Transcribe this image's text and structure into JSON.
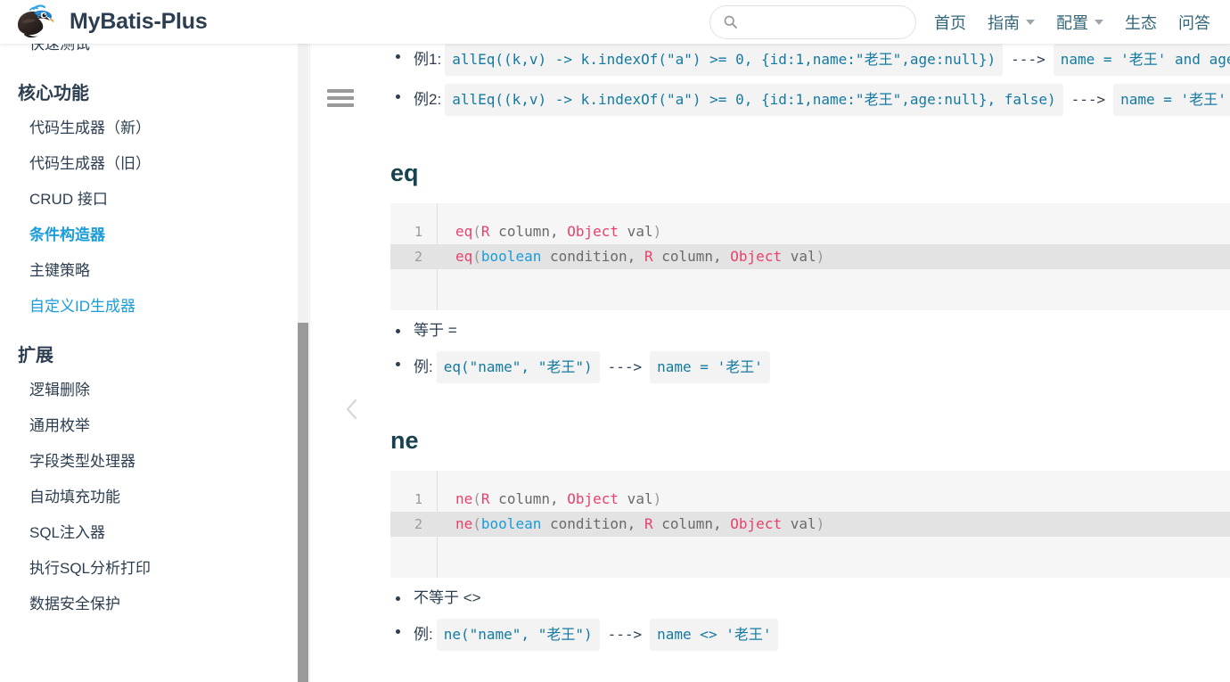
{
  "header": {
    "brand_title": "MyBatis-Plus",
    "logo_icon": "mybatis-plus-bird-logo",
    "search": {
      "icon": "search-icon",
      "value": "",
      "placeholder": ""
    },
    "nav_items": [
      {
        "label": "首页",
        "has_caret": false
      },
      {
        "label": "指南",
        "has_caret": true
      },
      {
        "label": "配置",
        "has_caret": true
      },
      {
        "label": "生态",
        "has_caret": false
      },
      {
        "label": "问答",
        "has_caret": false
      }
    ]
  },
  "sidebar": {
    "toggle_icon": "hamburger-menu-icon",
    "collapse_icon": "chevron-left-icon",
    "scrollbar": {
      "thumb_position_percent": 44
    },
    "blocks": [
      {
        "type": "link",
        "label": "快速测试",
        "state": "normal"
      },
      {
        "type": "group",
        "title": "核心功能",
        "items": [
          {
            "label": "代码生成器（新）",
            "state": "normal"
          },
          {
            "label": "代码生成器（旧）",
            "state": "normal"
          },
          {
            "label": "CRUD 接口",
            "state": "normal"
          },
          {
            "label": "条件构造器",
            "state": "active"
          },
          {
            "label": "主键策略",
            "state": "normal"
          },
          {
            "label": "自定义ID生成器",
            "state": "link"
          }
        ]
      },
      {
        "type": "group",
        "title": "扩展",
        "items": [
          {
            "label": "逻辑删除",
            "state": "normal"
          },
          {
            "label": "通用枚举",
            "state": "normal"
          },
          {
            "label": "字段类型处理器",
            "state": "normal"
          },
          {
            "label": "自动填充功能",
            "state": "normal"
          },
          {
            "label": "SQL注入器",
            "state": "normal"
          },
          {
            "label": "执行SQL分析打印",
            "state": "normal"
          },
          {
            "label": "数据安全保护",
            "state": "normal"
          }
        ]
      }
    ]
  },
  "main": {
    "alleq_examples": [
      {
        "label": "例1:",
        "call": "allEq((k,v) -> k.indexOf(\"a\") >= 0, {id:1,name:\"老王\",age:null})",
        "arrow": "--->",
        "result": "name = '老王' and age is null"
      },
      {
        "label": "例2:",
        "call": "allEq((k,v) -> k.indexOf(\"a\") >= 0, {id:1,name:\"老王\",age:null}, false)",
        "arrow": "--->",
        "result": "name = '老王'"
      }
    ],
    "sections": [
      {
        "heading": "eq",
        "code_lines": [
          {
            "num": "1",
            "highlighted": false,
            "tokens": [
              {
                "t": "eq",
                "c": "fn"
              },
              {
                "t": "(",
                "c": "p"
              },
              {
                "t": "R",
                "c": "type"
              },
              {
                "t": " column, ",
                "c": "plain"
              },
              {
                "t": "Object",
                "c": "type"
              },
              {
                "t": " val",
                "c": "plain"
              },
              {
                "t": ")",
                "c": "p"
              }
            ]
          },
          {
            "num": "2",
            "highlighted": true,
            "tokens": [
              {
                "t": "eq",
                "c": "fn"
              },
              {
                "t": "(",
                "c": "p"
              },
              {
                "t": "boolean",
                "c": "kw"
              },
              {
                "t": " condition, ",
                "c": "plain"
              },
              {
                "t": "R",
                "c": "type"
              },
              {
                "t": " column, ",
                "c": "plain"
              },
              {
                "t": "Object",
                "c": "type"
              },
              {
                "t": " val",
                "c": "plain"
              },
              {
                "t": ")",
                "c": "p"
              }
            ]
          }
        ],
        "notes": [
          {
            "label": "等于 =",
            "code": null,
            "arrow": null,
            "result": null
          },
          {
            "label": "例:",
            "code": "eq(\"name\", \"老王\")",
            "arrow": "--->",
            "result": "name = '老王'"
          }
        ]
      },
      {
        "heading": "ne",
        "code_lines": [
          {
            "num": "1",
            "highlighted": false,
            "tokens": [
              {
                "t": "ne",
                "c": "fn"
              },
              {
                "t": "(",
                "c": "p"
              },
              {
                "t": "R",
                "c": "type"
              },
              {
                "t": " column, ",
                "c": "plain"
              },
              {
                "t": "Object",
                "c": "type"
              },
              {
                "t": " val",
                "c": "plain"
              },
              {
                "t": ")",
                "c": "p"
              }
            ]
          },
          {
            "num": "2",
            "highlighted": true,
            "tokens": [
              {
                "t": "ne",
                "c": "fn"
              },
              {
                "t": "(",
                "c": "p"
              },
              {
                "t": "boolean",
                "c": "kw"
              },
              {
                "t": " condition, ",
                "c": "plain"
              },
              {
                "t": "R",
                "c": "type"
              },
              {
                "t": " column, ",
                "c": "plain"
              },
              {
                "t": "Object",
                "c": "type"
              },
              {
                "t": " val",
                "c": "plain"
              },
              {
                "t": ")",
                "c": "p"
              }
            ]
          }
        ],
        "notes": [
          {
            "label": "不等于 <>",
            "code": null,
            "arrow": null,
            "result": null
          },
          {
            "label": "例:",
            "code": "ne(\"name\", \"老王\")",
            "arrow": "--->",
            "result": "name <> '老王'"
          }
        ]
      }
    ]
  },
  "colors": {
    "brand_text": "#2c3e50",
    "accent": "#1a9cd8",
    "nav_link": "#34667a",
    "heading": "#16424f",
    "code_bg": "#f6f6f6",
    "code_highlight_bg": "#e3e3e3",
    "inline_code_text": "#147aa1",
    "token_function": "#e8416b",
    "token_keyword": "#1a9cd8"
  }
}
